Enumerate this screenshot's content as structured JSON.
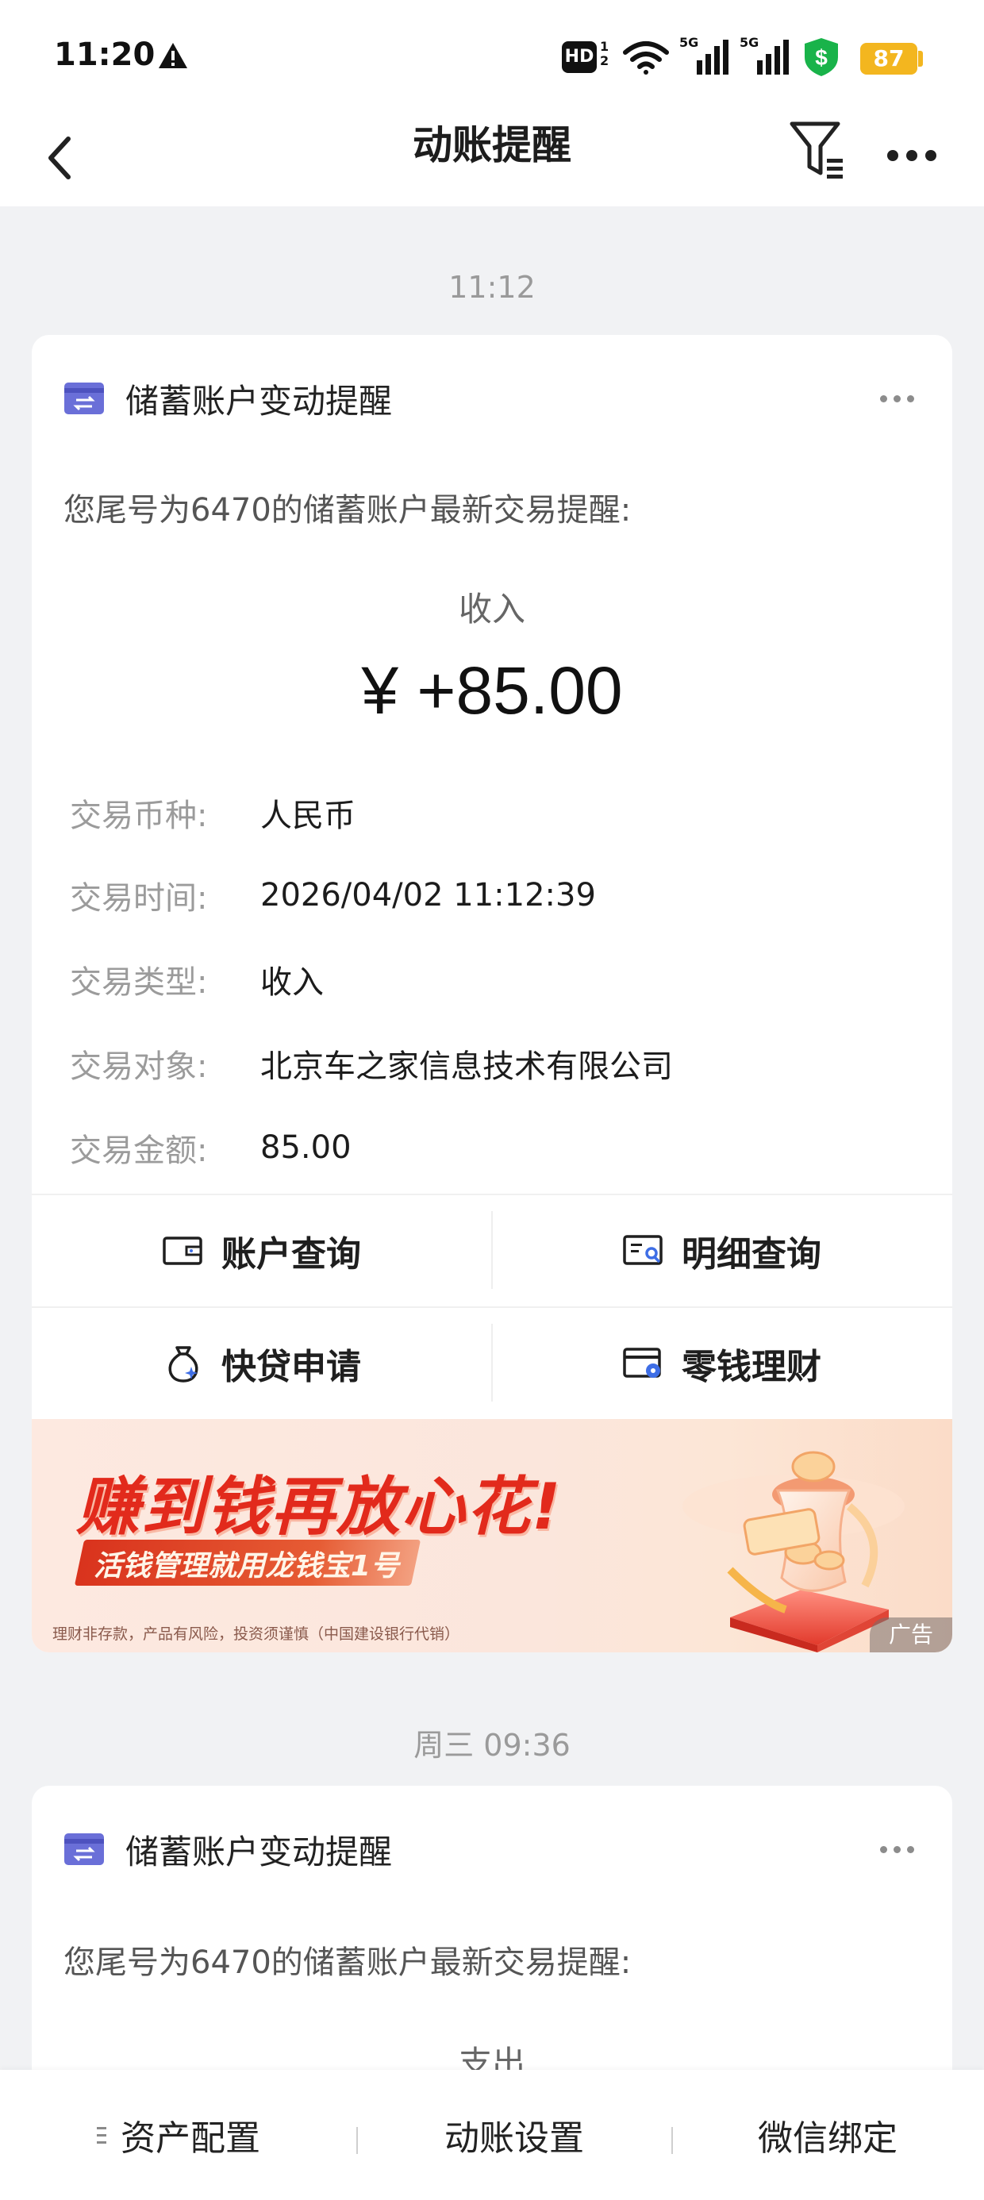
{
  "status_bar": {
    "time": "11:20",
    "hd_label": "HD",
    "hd_sub": "1\n2",
    "network_1": "5G",
    "network_2": "5G",
    "battery": "87"
  },
  "nav": {
    "title": "动账提醒",
    "back_icon": "chevron-left-icon",
    "filter_icon": "filter-list-icon",
    "more_icon": "more-horizontal-icon"
  },
  "messages": [
    {
      "time": "11:12",
      "title": "储蓄账户变动提醒",
      "intro": "您尾号为6470的储蓄账户最新交易提醒:",
      "type": "收入",
      "amount": "¥ +85.00",
      "details": [
        {
          "label": "交易币种:",
          "value": "人民币"
        },
        {
          "label": "交易时间:",
          "value": "2026/04/02 11:12:39"
        },
        {
          "label": "交易类型:",
          "value": "收入"
        },
        {
          "label": "交易对象:",
          "value": "北京车之家信息技术有限公司"
        },
        {
          "label": "交易金额:",
          "value": "85.00"
        }
      ],
      "actions": [
        {
          "label": "账户查询",
          "icon": "wallet-icon"
        },
        {
          "label": "明细查询",
          "icon": "statement-search-icon"
        },
        {
          "label": "快贷申请",
          "icon": "money-bag-icon"
        },
        {
          "label": "零钱理财",
          "icon": "card-settings-icon"
        }
      ],
      "ad": {
        "headline": "赚到钱再放心花!",
        "subline": "活钱管理就用龙钱宝1号",
        "disclaimer": "理财非存款，产品有风险，投资须谨慎（中国建设银行代销）",
        "tag": "广告"
      }
    },
    {
      "time": "周三 09:36",
      "title": "储蓄账户变动提醒",
      "intro": "您尾号为6470的储蓄账户最新交易提醒:",
      "type": "支出"
    }
  ],
  "bottom_bar": {
    "items": [
      "资产配置",
      "动账设置",
      "微信绑定"
    ]
  },
  "colors": {
    "accent_red": "#e22a1c",
    "battery": "#f3b61f",
    "shield": "#19b34a",
    "card_icon": "#6a6fd8"
  }
}
